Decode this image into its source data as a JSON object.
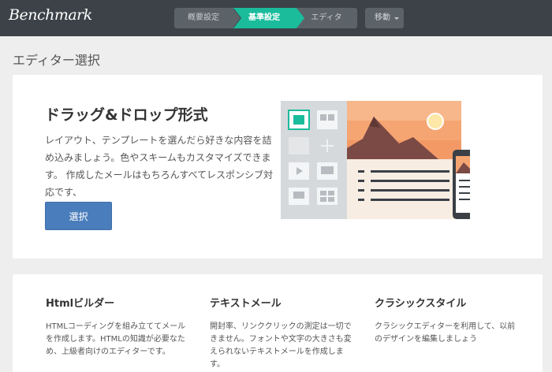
{
  "logo": "Benchmark",
  "steps": [
    "概要設定",
    "基準設定",
    "エディタ"
  ],
  "move_label": "移動",
  "page_title": "エディター選択",
  "dragdrop": {
    "title": "ドラッグ&ドロップ形式",
    "description": "レイアウト、テンプレートを選んだら好きな内容を詰め込みましょう。色やスキームもカスタマイズできます。 作成したメールはもちろんすべてレスポンシブ対応です、",
    "button": "選択"
  },
  "options": [
    {
      "title": "Htmlビルダー",
      "description": "HTMLコーディングを組み立ててメールを作成します。HTMLの知識が必要なため、上級者向けのエディターです。"
    },
    {
      "title": "テキストメール",
      "description": "開封率、リンククリックの測定は一切できません。フォントや文字の大きさも変えられないテキストメールを作成します。"
    },
    {
      "title": "クラシックスタイル",
      "description": "クラシックエディターを利用して、以前のデザインを編集しましょう"
    }
  ],
  "colors": {
    "topbar": "#3c4248",
    "active_step": "#1abc9c",
    "button": "#4a7dbb"
  }
}
